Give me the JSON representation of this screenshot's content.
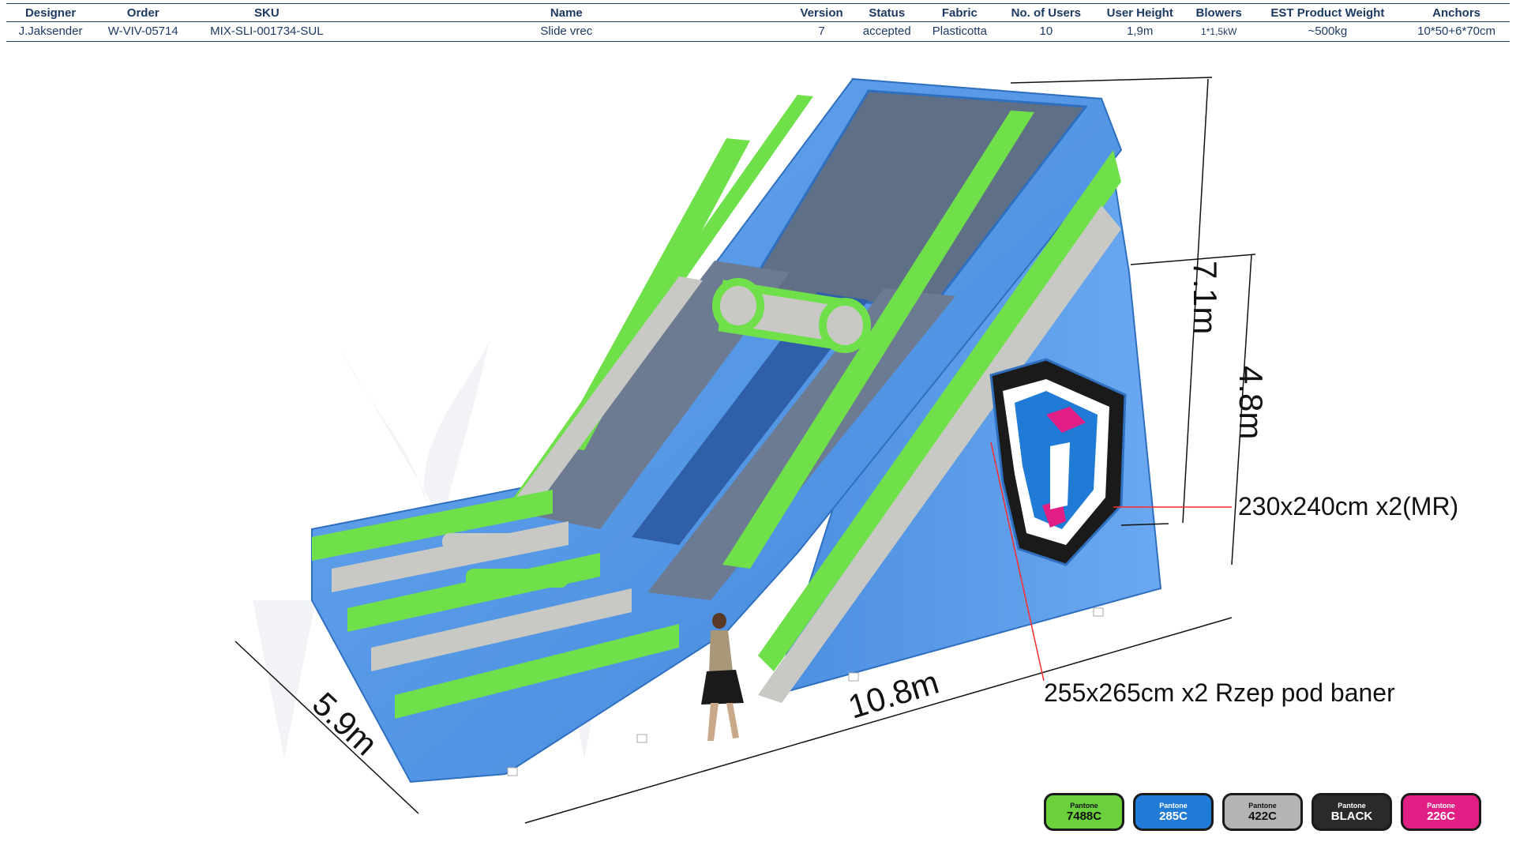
{
  "spec": {
    "headers": [
      "Designer",
      "Order",
      "SKU",
      "Name",
      "Version",
      "Status",
      "Fabric",
      "No. of Users",
      "User  Height",
      "Blowers",
      "EST Product Weight",
      "Anchors"
    ],
    "values": [
      "J.Jaksender",
      "W-VIV-05714",
      "MIX-SLI-001734-SUL",
      "Slide vrec",
      "7",
      "accepted",
      "Plasticotta",
      "10",
      "1,9m",
      "1*1,5kW",
      "~500kg",
      "10*50+6*70cm"
    ]
  },
  "dimensions": {
    "height_total": "7.1m",
    "height_side": "4.8m",
    "length": "10.8m",
    "width": "5.9m"
  },
  "callouts": {
    "banner_mr": "230x240cm x2(MR)",
    "banner_velcro": "255x265cm x2 Rzep pod baner"
  },
  "colors": {
    "blue_body": "#5b9ae6",
    "green_stripe": "#6fe04a",
    "grey_stripe": "#c8c8c4"
  },
  "pantone": [
    {
      "label": "Pantone",
      "code": "7488C",
      "bg": "#6ad03c",
      "fg": "#111111"
    },
    {
      "label": "Pantone",
      "code": "285C",
      "bg": "#1f7bd6",
      "fg": "#ffffff"
    },
    {
      "label": "Pantone",
      "code": "422C",
      "bg": "#b4b4b2",
      "fg": "#111111"
    },
    {
      "label": "Pantone",
      "code": "BLACK",
      "bg": "#2a2a2a",
      "fg": "#ffffff"
    },
    {
      "label": "Pantone",
      "code": "226C",
      "bg": "#e01e83",
      "fg": "#ffffff"
    }
  ]
}
